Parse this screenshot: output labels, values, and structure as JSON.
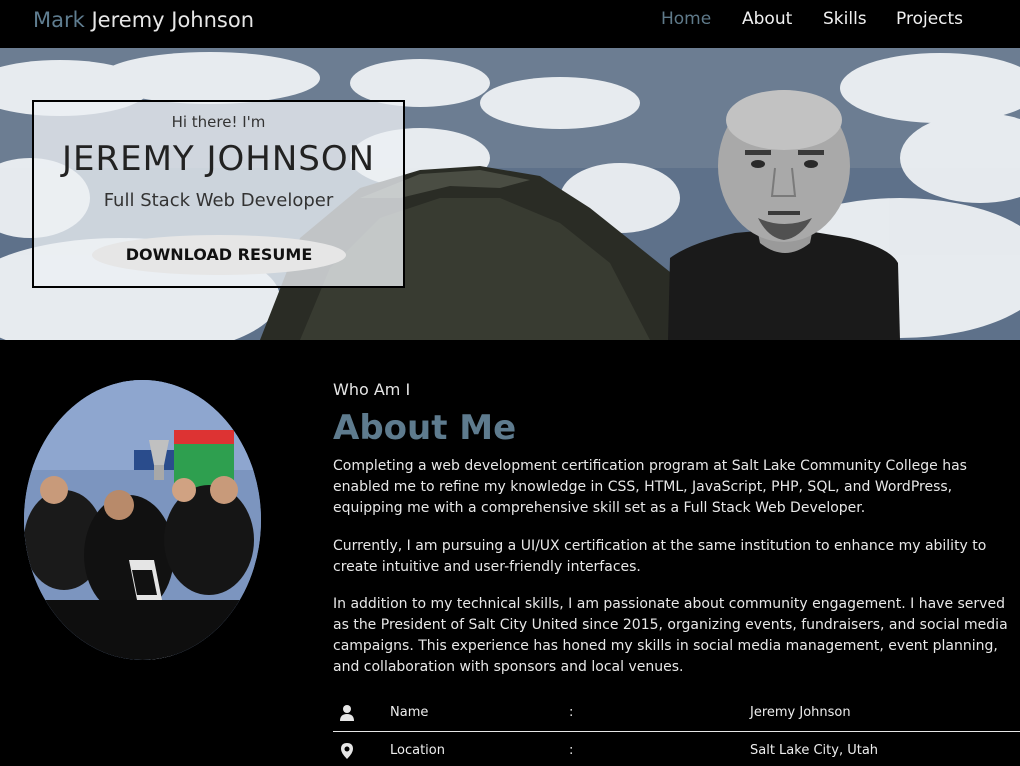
{
  "navbar": {
    "brand_first": "Mark",
    "brand_rest": "Jeremy Johnson",
    "links": [
      "Home",
      "About",
      "Skills",
      "Projects"
    ],
    "active": "Home"
  },
  "hero": {
    "greeting": "Hi there! I'm",
    "name": "JEREMY JOHNSON",
    "role": "Full Stack Web Developer",
    "resume_button": "DOWNLOAD RESUME"
  },
  "about": {
    "subtitle": "Who Am I",
    "title": "About Me",
    "paragraphs": [
      "Completing a web development certification program at Salt Lake Community College has enabled me to refine my knowledge in CSS, HTML, JavaScript, PHP, SQL, and WordPress, equipping me with a comprehensive skill set as a Full Stack Web Developer.",
      "Currently, I am pursuing a UI/UX certification at the same institution to enhance my ability to create intuitive and user-friendly interfaces.",
      "In addition to my technical skills, I am passionate about community engagement. I have served as the President of Salt City United since 2015, organizing events, fundraisers, and social media campaigns. This experience has honed my skills in social media management, event planning, and collaboration with sponsors and local venues."
    ],
    "info": [
      {
        "icon": "person-icon",
        "label": "Name",
        "sep": ":",
        "value": "Jeremy Johnson"
      },
      {
        "icon": "location-pin-icon",
        "label": "Location",
        "sep": ":",
        "value": "Salt Lake City, Utah"
      }
    ]
  },
  "colors": {
    "accent": "#5e7b8e",
    "background": "#000000",
    "text": "#e8e8e8"
  }
}
